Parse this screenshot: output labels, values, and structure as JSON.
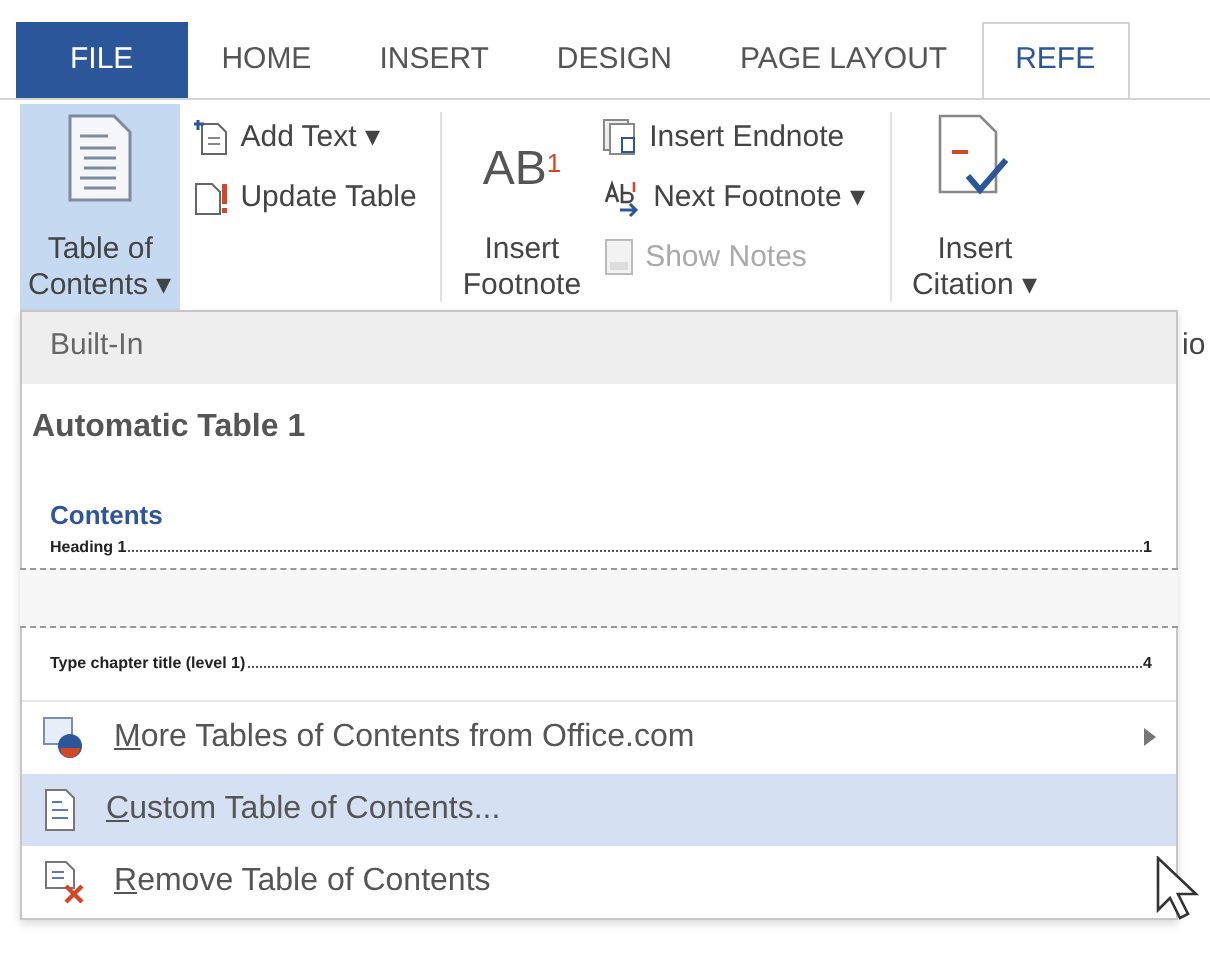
{
  "tabs": [
    {
      "label": "FILE",
      "kind": "backstage",
      "selected": false
    },
    {
      "label": "HOME",
      "kind": "tab",
      "selected": false
    },
    {
      "label": "INSERT",
      "kind": "tab",
      "selected": false
    },
    {
      "label": "DESIGN",
      "kind": "tab",
      "selected": false
    },
    {
      "label": "PAGE LAYOUT",
      "kind": "tab",
      "selected": false
    },
    {
      "label": "REFE",
      "kind": "tab",
      "selected": true
    }
  ],
  "ribbon": {
    "toc_button": {
      "label_lines": [
        "Table of",
        "Contents ▾"
      ],
      "pressed": true
    },
    "toc_small": [
      {
        "label": "Add Text ▾",
        "disabled": false
      },
      {
        "label": "Update Table",
        "disabled": false
      }
    ],
    "footnote_button": {
      "glyph": "AB$^{1}$",
      "label_lines": [
        "Insert",
        "Footnote"
      ]
    },
    "footnote_small": [
      {
        "label": "Insert Endnote",
        "disabled": false
      },
      {
        "label": "Next Footnote  ▾",
        "disabled": false
      },
      {
        "label": "Show Notes",
        "disabled": true
      }
    ],
    "citation_button": {
      "label_lines": [
        "Insert",
        "Citation ▾"
      ]
    },
    "partial_label": "io"
  },
  "dropdown": {
    "header": "Built-In",
    "gallery_title": "Automatic Table 1",
    "preview_heading": "Contents",
    "preview_rows": [
      {
        "text": "Heading 1",
        "page": "1"
      }
    ],
    "preview_rows_after_cut": [
      {
        "text": "Type chapter title (level 1)",
        "page": "4"
      }
    ],
    "menu_items": [
      {
        "label": "More Tables of Contents from Office.com",
        "submenu": true,
        "selected": false,
        "underline_first": true
      },
      {
        "label": "Custom Table of Contents...",
        "submenu": false,
        "selected": true,
        "underline_first": true
      },
      {
        "label": "Remove Table of Contents",
        "submenu": false,
        "selected": false,
        "underline_first": true
      }
    ]
  }
}
